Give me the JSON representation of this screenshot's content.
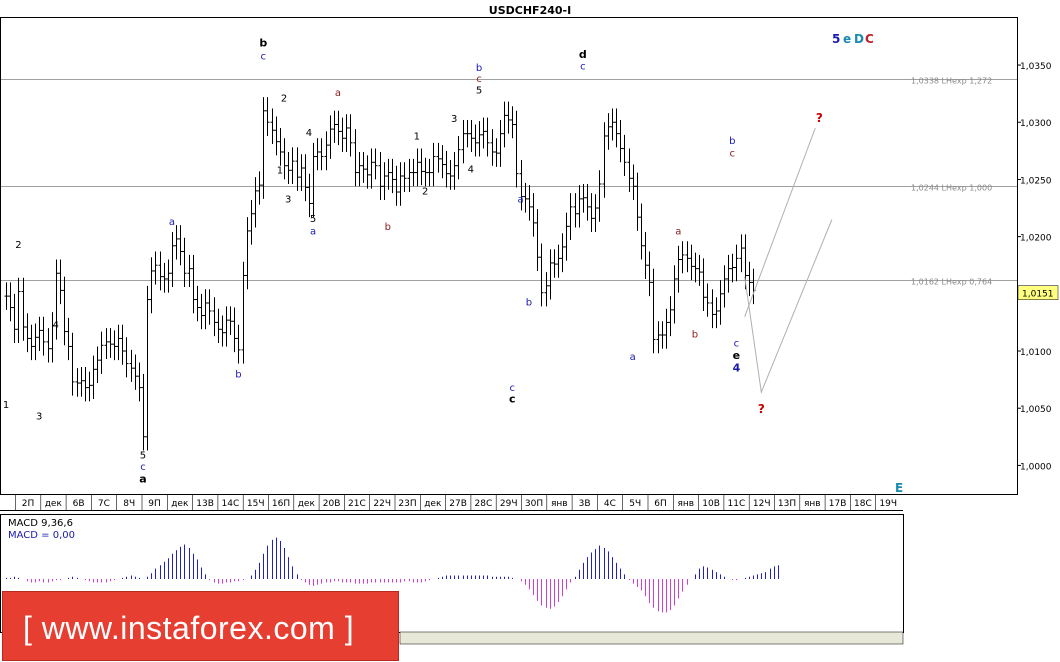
{
  "chart_data": {
    "type": "candlestick",
    "title": "USDCHF240-I",
    "ylim": [
      0.9975,
      1.0392
    ],
    "y_ticks": [
      "1,0000",
      "1,0050",
      "1,0100",
      "1,0150",
      "1,0200",
      "1,0250",
      "1,0300",
      "1,0350"
    ],
    "current_price": "1,0151",
    "x_labels": [
      "2П",
      "дек",
      "6В",
      "7С",
      "8Ч",
      "9П",
      "дек",
      "13В",
      "14С",
      "15Ч",
      "16П",
      "дек",
      "20В",
      "21С",
      "22Ч",
      "23П",
      "дек",
      "27В",
      "28С",
      "29Ч",
      "30П",
      "янв",
      "3В",
      "4С",
      "5Ч",
      "6П",
      "янв",
      "10В",
      "11С",
      "12Ч",
      "13П",
      "янв",
      "17В",
      "18С",
      "19Ч"
    ],
    "hlines": [
      {
        "price": 1.0338,
        "label": "1,0338 LНехр 1,272"
      },
      {
        "price": 1.0244,
        "label": "1,0244 LНехр 1,000"
      },
      {
        "price": 1.0162,
        "label": "1,0162 LНехр 0,764"
      }
    ],
    "close_series": [
      1.0148,
      1.0138,
      1.0119,
      1.0152,
      1.0121,
      1.0111,
      1.0104,
      1.0112,
      1.0118,
      1.0108,
      1.0102,
      1.0122,
      1.0168,
      1.0153,
      1.0117,
      1.0104,
      1.0073,
      1.0072,
      1.0074,
      1.0068,
      1.007,
      1.0084,
      1.0092,
      1.0105,
      1.0108,
      1.0106,
      1.0104,
      1.0111,
      1.01,
      1.0089,
      1.0085,
      1.0078,
      1.0068,
      1.0025,
      1.0145,
      1.017,
      1.0175,
      1.0165,
      1.0163,
      1.0168,
      1.0192,
      1.0198,
      1.0187,
      1.0168,
      1.0172,
      1.0145,
      1.0138,
      1.0131,
      1.0142,
      1.0135,
      1.0125,
      1.0119,
      1.0116,
      1.0127,
      1.0126,
      1.0111,
      1.0101,
      1.0166,
      1.0205,
      1.022,
      1.024,
      1.0245,
      1.031,
      1.03,
      1.0293,
      1.0283,
      1.0274,
      1.0262,
      1.0258,
      1.0266,
      1.0252,
      1.026,
      1.0243,
      1.0229,
      1.027,
      1.0274,
      1.027,
      1.028,
      1.0294,
      1.0298,
      1.0292,
      1.0286,
      1.0295,
      1.0282,
      1.0256,
      1.0262,
      1.0259,
      1.0254,
      1.0265,
      1.0262,
      1.0244,
      1.0253,
      1.0256,
      1.025,
      1.0239,
      1.0253,
      1.0251,
      1.0256,
      1.0256,
      1.0265,
      1.0257,
      1.0256,
      1.0256,
      1.027,
      1.0268,
      1.0263,
      1.0255,
      1.0253,
      1.0262,
      1.0276,
      1.029,
      1.029,
      1.0286,
      1.0282,
      1.0289,
      1.0292,
      1.0282,
      1.0274,
      1.0273,
      1.029,
      1.0306,
      1.0302,
      1.0298,
      1.0255,
      1.0235,
      1.0233,
      1.0226,
      1.0212,
      1.0182,
      1.0151,
      1.0157,
      1.0177,
      1.0176,
      1.0181,
      1.0191,
      1.0209,
      1.0226,
      1.022,
      1.0233,
      1.0234,
      1.0226,
      1.0216,
      1.0225,
      1.0246,
      1.0288,
      1.0296,
      1.03,
      1.029,
      1.0277,
      1.0265,
      1.0251,
      1.0244,
      1.0217,
      1.0192,
      1.0175,
      1.016,
      1.011,
      1.0114,
      1.0114,
      1.0125,
      1.0136,
      1.0163,
      1.018,
      1.0184,
      1.0181,
      1.0174,
      1.0172,
      1.0169,
      1.0147,
      1.0142,
      1.0132,
      1.0135,
      1.015,
      1.0163,
      1.0172,
      1.0173,
      1.0181,
      1.019,
      1.0166,
      1.016,
      1.0153
    ],
    "wave_labels": [
      {
        "i": 3,
        "p": 1.019,
        "text": "2",
        "color": "#000000"
      },
      {
        "i": 0,
        "p": 1.005,
        "text": "1",
        "color": "#000000"
      },
      {
        "i": 8,
        "p": 1.004,
        "text": "3",
        "color": "#000000"
      },
      {
        "i": 12,
        "p": 1.012,
        "text": "4",
        "color": "#000000"
      },
      {
        "i": 33,
        "p": 1.0006,
        "text": "5",
        "color": "#000000"
      },
      {
        "i": 33,
        "p": 0.9996,
        "text": "c",
        "color": "#1a1ab0"
      },
      {
        "i": 33,
        "p": 0.9985,
        "text": "a",
        "color": "#000000",
        "bold": true
      },
      {
        "i": 40,
        "p": 1.021,
        "text": "a",
        "color": "#1a1ab0"
      },
      {
        "i": 56,
        "p": 1.0077,
        "text": "b",
        "color": "#1a1ab0"
      },
      {
        "i": 62,
        "p": 1.0366,
        "text": "b",
        "color": "#000000",
        "bold": true
      },
      {
        "i": 62,
        "p": 1.0355,
        "text": "c",
        "color": "#1a1ab0"
      },
      {
        "i": 67,
        "p": 1.0318,
        "text": "2",
        "color": "#000000"
      },
      {
        "i": 66,
        "p": 1.0255,
        "text": "1",
        "color": "#000000"
      },
      {
        "i": 68,
        "p": 1.023,
        "text": "3",
        "color": "#000000"
      },
      {
        "i": 73,
        "p": 1.0288,
        "text": "4",
        "color": "#000000"
      },
      {
        "i": 74,
        "p": 1.0213,
        "text": "5",
        "color": "#000000"
      },
      {
        "i": 74,
        "p": 1.0202,
        "text": "a",
        "color": "#1a1ab0"
      },
      {
        "i": 80,
        "p": 1.0323,
        "text": "a",
        "color": "#8b1a1a"
      },
      {
        "i": 92,
        "p": 1.0206,
        "text": "b",
        "color": "#8b1a1a"
      },
      {
        "i": 99,
        "p": 1.0285,
        "text": "1",
        "color": "#000000"
      },
      {
        "i": 101,
        "p": 1.0237,
        "text": "2",
        "color": "#000000"
      },
      {
        "i": 108,
        "p": 1.03,
        "text": "3",
        "color": "#000000"
      },
      {
        "i": 112,
        "p": 1.0256,
        "text": "4",
        "color": "#000000"
      },
      {
        "i": 114,
        "p": 1.0345,
        "text": "b",
        "color": "#1a1ab0"
      },
      {
        "i": 114,
        "p": 1.0335,
        "text": "c",
        "color": "#8b1a1a"
      },
      {
        "i": 114,
        "p": 1.0325,
        "text": "5",
        "color": "#000000"
      },
      {
        "i": 124,
        "p": 1.023,
        "text": "a",
        "color": "#1a1ab0"
      },
      {
        "i": 126,
        "p": 1.014,
        "text": "b",
        "color": "#1a1ab0"
      },
      {
        "i": 122,
        "p": 1.0065,
        "text": "c",
        "color": "#1a1ab0"
      },
      {
        "i": 122,
        "p": 1.0055,
        "text": "c",
        "color": "#000000",
        "bold": true
      },
      {
        "i": 139,
        "p": 1.0356,
        "text": "d",
        "color": "#000000",
        "bold": true
      },
      {
        "i": 139,
        "p": 1.0346,
        "text": "c",
        "color": "#1a1ab0"
      },
      {
        "i": 151,
        "p": 1.0092,
        "text": "a",
        "color": "#1a1ab0"
      },
      {
        "i": 162,
        "p": 1.0202,
        "text": "a",
        "color": "#8b1a1a"
      },
      {
        "i": 166,
        "p": 1.0112,
        "text": "b",
        "color": "#8b1a1a"
      },
      {
        "i": 175,
        "p": 1.0281,
        "text": "b",
        "color": "#1a1ab0"
      },
      {
        "i": 175,
        "p": 1.027,
        "text": "c",
        "color": "#8b1a1a"
      },
      {
        "i": 176,
        "p": 1.0104,
        "text": "c",
        "color": "#1a1ab0"
      },
      {
        "i": 176,
        "p": 1.0093,
        "text": "e",
        "color": "#000000",
        "bold": true
      },
      {
        "i": 176,
        "p": 1.0082,
        "text": "4",
        "color": "#1a1ab0",
        "bold": true
      }
    ],
    "header_labels": [
      {
        "text": "5",
        "color": "#1a1ab0"
      },
      {
        "text": "e",
        "color": "#1a8ab0"
      },
      {
        "text": "D",
        "color": "#1a8ab0"
      },
      {
        "text": "C",
        "color": "#c0202a"
      }
    ],
    "corner_label": {
      "text": "E",
      "color": "#1a8ab0"
    },
    "projection_marks": [
      {
        "text": "?",
        "color": "#cc0000",
        "p": 1.03,
        "i": 196
      },
      {
        "text": "?",
        "color": "#cc0000",
        "p": 1.0046,
        "i": 182
      }
    ],
    "projections": [
      [
        [
          178,
          1.013
        ],
        [
          195,
          1.0295
        ]
      ],
      [
        [
          178,
          1.0165
        ],
        [
          182,
          1.0064
        ],
        [
          199,
          1.0215
        ]
      ]
    ],
    "macd": {
      "label1": "MACD 9,36,6",
      "label2": "MACD = 0,00",
      "values": [
        1,
        1,
        2,
        1,
        0,
        -2,
        -3,
        -3,
        -2,
        -3,
        -3,
        -2,
        -1,
        -1,
        0,
        1,
        2,
        1,
        0,
        -1,
        -2,
        -3,
        -3,
        -3,
        -3,
        -2,
        -1,
        0,
        1,
        2,
        3,
        2,
        1,
        0,
        2,
        5,
        9,
        12,
        15,
        18,
        22,
        25,
        28,
        30,
        27,
        22,
        17,
        10,
        4,
        -1,
        -3,
        -4,
        -4,
        -3,
        -3,
        -2,
        -2,
        -1,
        0,
        3,
        8,
        14,
        22,
        29,
        34,
        36,
        33,
        27,
        19,
        11,
        4,
        -1,
        -3,
        -5,
        -6,
        -5,
        -4,
        -3,
        -3,
        -2,
        -2,
        -3,
        -3,
        -3,
        -4,
        -4,
        -4,
        -4,
        -3,
        -3,
        -3,
        -3,
        -3,
        -3,
        -3,
        -3,
        -2,
        -2,
        -3,
        -3,
        -3,
        -2,
        -1,
        0,
        1,
        2,
        3,
        3,
        3,
        3,
        3,
        3,
        3,
        3,
        3,
        3,
        3,
        2,
        2,
        2,
        2,
        2,
        1,
        0,
        -2,
        -5,
        -9,
        -14,
        -19,
        -23,
        -25,
        -26,
        -24,
        -20,
        -15,
        -9,
        -3,
        2,
        8,
        14,
        19,
        23,
        26,
        29,
        27,
        24,
        19,
        14,
        9,
        4,
        -1,
        -4,
        -7,
        -10,
        -15,
        -21,
        -25,
        -28,
        -29,
        -29,
        -27,
        -23,
        -17,
        -11,
        -5,
        0,
        4,
        9,
        11,
        10,
        8,
        6,
        4,
        2,
        0,
        -1,
        -1,
        0,
        1,
        2,
        3,
        4,
        5,
        6,
        9,
        11,
        12
      ]
    }
  },
  "watermark": {
    "text": "[  www.instaforex.com ]"
  }
}
